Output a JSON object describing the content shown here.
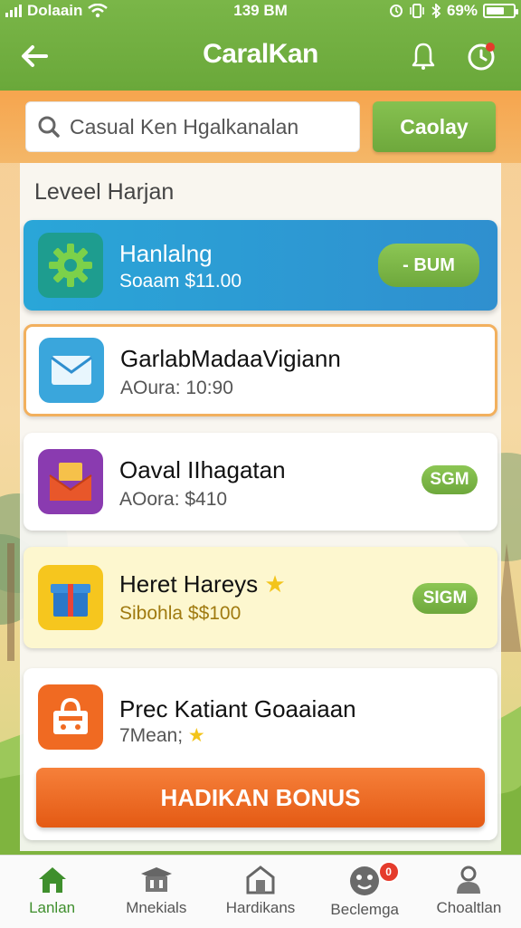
{
  "status_bar": {
    "carrier": "Dolaain",
    "time": "139 BM",
    "battery": "69%",
    "battery_level": 0.69
  },
  "header": {
    "title": "CaralKan"
  },
  "search": {
    "placeholder": "Casual Ken Hgalkanalan",
    "button_label": "Caolay"
  },
  "section": {
    "title": "Leveel Harjan"
  },
  "offers": [
    {
      "title": "Hanlalng",
      "subtitle": "Soaam $11.00",
      "action_label": "- BUM",
      "icon": "gear-icon",
      "style": "featured-blue"
    },
    {
      "title": "GarlabMadaaVigiann",
      "subtitle": "AOura: 10:90",
      "icon": "mail-icon",
      "style": "highlighted-orange"
    },
    {
      "title": "Oaval IIhagatan",
      "subtitle": "AOora: $410",
      "action_label": "SGM",
      "icon": "envelope-gift-icon",
      "style": "default"
    },
    {
      "title": "Heret Hareys",
      "subtitle": "Sibohla $$100",
      "action_label": "SIGM",
      "icon": "gift-box-icon",
      "style": "highlighted-yellow",
      "has_star": true
    },
    {
      "title": "Prec Katiant Goaaiaan",
      "subtitle": "7Mean;",
      "icon": "shopping-basket-icon",
      "style": "default",
      "has_star": true
    }
  ],
  "cta": {
    "label": "HADIKAN BONUS"
  },
  "bottom_nav": [
    {
      "label": "Lanlan",
      "icon": "home-icon",
      "active": true
    },
    {
      "label": "Mnekials",
      "icon": "graduation-icon",
      "active": false
    },
    {
      "label": "Hardikans",
      "icon": "building-icon",
      "active": false
    },
    {
      "label": "Beclemga",
      "icon": "game-icon",
      "active": false,
      "badge": "0"
    },
    {
      "label": "Choaltlan",
      "icon": "user-icon",
      "active": false
    }
  ],
  "colors": {
    "brand_green": "#6aa83a",
    "accent_orange": "#e45a14",
    "featured_blue": "#2f8fcf"
  }
}
